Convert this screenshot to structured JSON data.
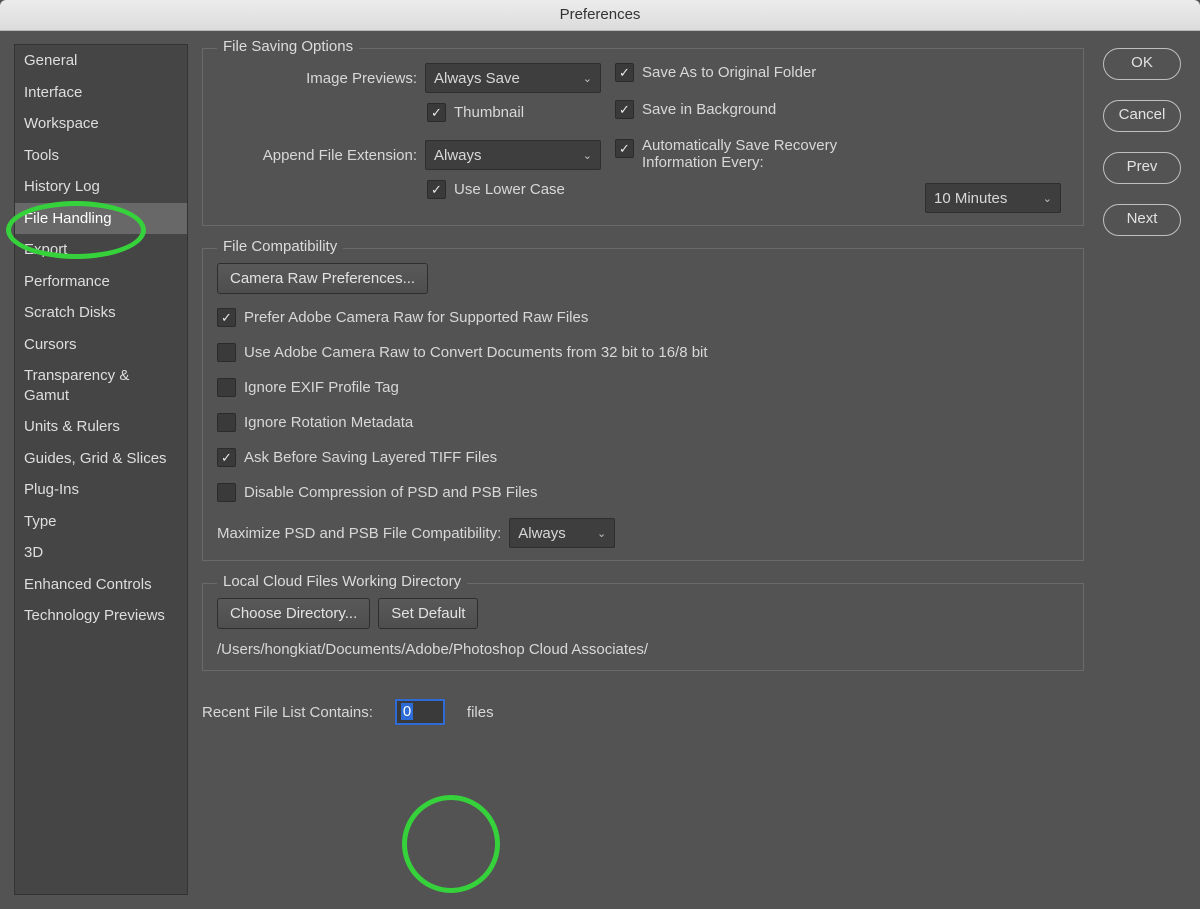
{
  "title": "Preferences",
  "sidebar": {
    "items": [
      {
        "label": "General"
      },
      {
        "label": "Interface"
      },
      {
        "label": "Workspace"
      },
      {
        "label": "Tools"
      },
      {
        "label": "History Log"
      },
      {
        "label": "File Handling"
      },
      {
        "label": "Export"
      },
      {
        "label": "Performance"
      },
      {
        "label": "Scratch Disks"
      },
      {
        "label": "Cursors"
      },
      {
        "label": "Transparency & Gamut"
      },
      {
        "label": "Units & Rulers"
      },
      {
        "label": "Guides, Grid & Slices"
      },
      {
        "label": "Plug-Ins"
      },
      {
        "label": "Type"
      },
      {
        "label": "3D"
      },
      {
        "label": "Enhanced Controls"
      },
      {
        "label": "Technology Previews"
      }
    ],
    "selected_index": 5
  },
  "buttons": {
    "ok": "OK",
    "cancel": "Cancel",
    "prev": "Prev",
    "next": "Next"
  },
  "saving": {
    "legend": "File Saving Options",
    "image_previews_label": "Image Previews:",
    "image_previews_value": "Always Save",
    "thumbnail_label": "Thumbnail",
    "append_ext_label": "Append File Extension:",
    "append_ext_value": "Always",
    "lowercase_label": "Use Lower Case",
    "save_as_original_label": "Save As to Original Folder",
    "save_background_label": "Save in Background",
    "autosave_label": "Automatically Save Recovery Information Every:",
    "autosave_value": "10 Minutes"
  },
  "compat": {
    "legend": "File Compatibility",
    "cameraraw_btn": "Camera Raw Preferences...",
    "prefer_acr_label": "Prefer Adobe Camera Raw for Supported Raw Files",
    "use_acr_convert_label": "Use Adobe Camera Raw to Convert Documents from 32 bit to 16/8 bit",
    "ignore_exif_label": "Ignore EXIF Profile Tag",
    "ignore_rotation_label": "Ignore Rotation Metadata",
    "ask_tiff_label": "Ask Before Saving Layered TIFF Files",
    "disable_compression_label": "Disable Compression of PSD and PSB Files",
    "maximize_psd_label": "Maximize PSD and PSB File Compatibility:",
    "maximize_psd_value": "Always"
  },
  "cloud": {
    "legend": "Local Cloud Files Working Directory",
    "choose_btn": "Choose Directory...",
    "default_btn": "Set Default",
    "path": "/Users/hongkiat/Documents/Adobe/Photoshop Cloud Associates/"
  },
  "recent": {
    "label": "Recent File List Contains:",
    "value": "0",
    "suffix": "files"
  }
}
